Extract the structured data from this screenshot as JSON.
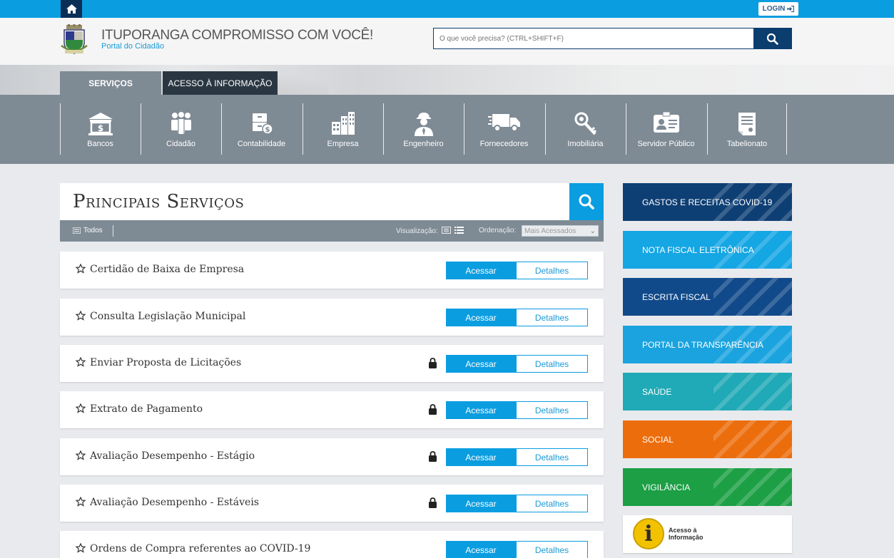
{
  "topbar": {
    "login_label": "LOGIN"
  },
  "header": {
    "title": "ITUPORANGA COMPROMISSO COM VOCÊ!",
    "subtitle": "Portal do Cidadão",
    "search_placeholder": "O que você precisa? (CTRL+SHIFT+F)"
  },
  "tabs": {
    "servicos": "SERVIÇOS",
    "acesso": "ACESSO À INFORMAÇÃO"
  },
  "categories": [
    {
      "label": "Bancos",
      "icon": "bank-icon"
    },
    {
      "label": "Cidadão",
      "icon": "people-icon"
    },
    {
      "label": "Contabilidade",
      "icon": "cabinet-icon"
    },
    {
      "label": "Empresa",
      "icon": "buildings-icon"
    },
    {
      "label": "Engenheiro",
      "icon": "engineer-icon"
    },
    {
      "label": "Fornecedores",
      "icon": "truck-icon"
    },
    {
      "label": "Imobiliária",
      "icon": "key-icon"
    },
    {
      "label": "Servidor Público",
      "icon": "id-card-icon"
    },
    {
      "label": "Tabelionato",
      "icon": "document-icon"
    }
  ],
  "main": {
    "title": "Principais Serviços",
    "filter_all": "Todos",
    "view_label": "Visualização:",
    "order_label": "Ordenação:",
    "order_value": "Mais Acessados",
    "acessar_label": "Acessar",
    "detalhes_label": "Detalhes",
    "services": [
      {
        "title": "Certidão de Baixa de Empresa",
        "locked": false
      },
      {
        "title": "Consulta Legislação Municipal",
        "locked": false
      },
      {
        "title": "Enviar Proposta de Licitações",
        "locked": true
      },
      {
        "title": "Extrato de Pagamento",
        "locked": true
      },
      {
        "title": "Avaliação Desempenho - Estágio",
        "locked": true
      },
      {
        "title": "Avaliação Desempenho - Estáveis",
        "locked": true
      },
      {
        "title": "Ordens de Compra referentes ao COVID-19",
        "locked": false
      }
    ]
  },
  "sidebar": {
    "tiles": [
      {
        "label": "GASTOS E RECEITAS COVID-19",
        "color": "#0e3f74"
      },
      {
        "label": "NOTA FISCAL ELETRÔNICA",
        "color": "#15a6e4"
      },
      {
        "label": "ESCRITA FISCAL",
        "color": "#114a8a"
      },
      {
        "label": "PORTAL DA TRANSPARÊNCIA",
        "color": "#1aa3df"
      },
      {
        "label": "SAÚDE",
        "color": "#20a9b6"
      },
      {
        "label": "SOCIAL",
        "color": "#ec6d0c"
      },
      {
        "label": "VIGILÂNCIA",
        "color": "#1c9f45"
      }
    ],
    "acesso_info_text": "Acesso à Informação",
    "acesso_info_letter": "i"
  }
}
